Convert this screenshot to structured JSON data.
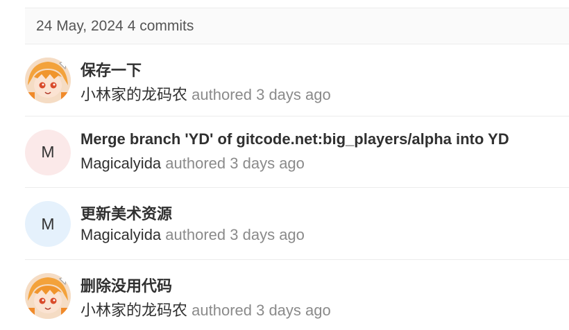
{
  "group": {
    "date": "24 May, 2024",
    "count": "4 commits"
  },
  "commits": [
    {
      "title": "保存一下",
      "author": "小林家的龙码农",
      "meta": "authored 3 days ago",
      "avatar": "anime-avatar-icon"
    },
    {
      "title": "Merge branch 'YD' of gitcode.net:big_players/alpha into YD",
      "author": "Magicalyida",
      "meta": "authored 3 days ago",
      "avatar_letter": "M"
    },
    {
      "title": "更新美术资源",
      "author": "Magicalyida",
      "meta": "authored 3 days ago",
      "avatar_letter": "M"
    },
    {
      "title": "删除没用代码",
      "author": "小林家的龙码农",
      "meta": "authored 3 days ago",
      "avatar": "anime-avatar-icon"
    }
  ]
}
